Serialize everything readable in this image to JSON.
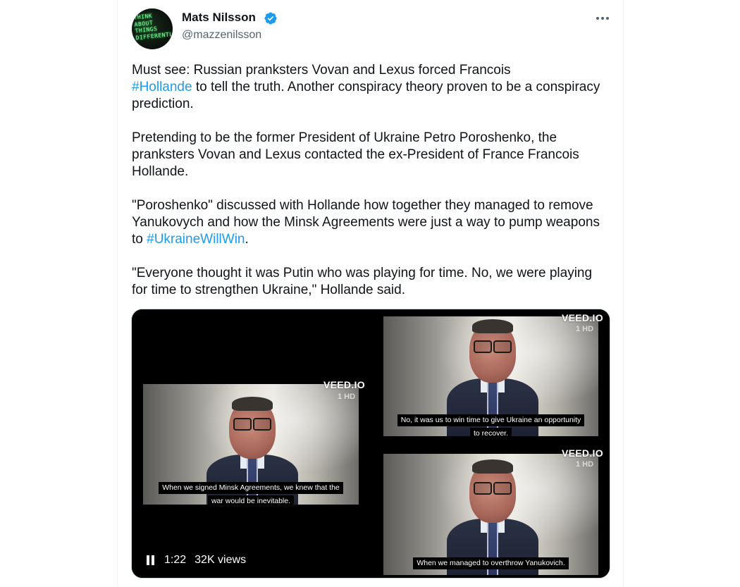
{
  "author": {
    "display_name": "Mats Nilsson",
    "handle": "@mazzenilsson",
    "avatar_text": "THINK ABOUT THINGS DIFFERENTLY"
  },
  "tweet": {
    "p1_a": "Must see: Russian pranksters Vovan and Lexus forced Francois",
    "p1_hashtag": "#Hollande",
    "p1_b": " to tell the truth. Another conspiracy theory proven to be a conspiracy prediction.",
    "p2": "Pretending to be the former President of Ukraine Petro Poroshenko, the pranksters Vovan and Lexus contacted the ex-President of France Francois Hollande.",
    "p3_a": "\"Poroshenko\" discussed with Hollande how together they managed to remove Yanukovych and how the Minsk Agreements were just a way to pump weapons to ",
    "p3_hashtag": "#UkraineWillWin",
    "p3_b": ".",
    "p4": "\"Everyone thought it was Putin who was playing for time. No, we were playing for time to strengthen Ukraine,\" Hollande said."
  },
  "media": {
    "watermark": "VEED.IO",
    "channel_logo": "1 HD",
    "main_caption_1": "When we signed Minsk Agreements, we knew that the",
    "main_caption_2": "war would be inevitable.",
    "top_caption_1": "No, it was us to win time to give Ukraine an opportunity",
    "top_caption_2": "to recover.",
    "bottom_caption_1": "When we managed to overthrow Yanukovich.",
    "time": "1:22",
    "views": "32K views"
  },
  "colors": {
    "accent": "#1d9bf0",
    "text": "#0f1419",
    "secondary": "#536471"
  },
  "icons": [
    "verified-badge-icon",
    "more-options-icon",
    "pause-icon"
  ]
}
